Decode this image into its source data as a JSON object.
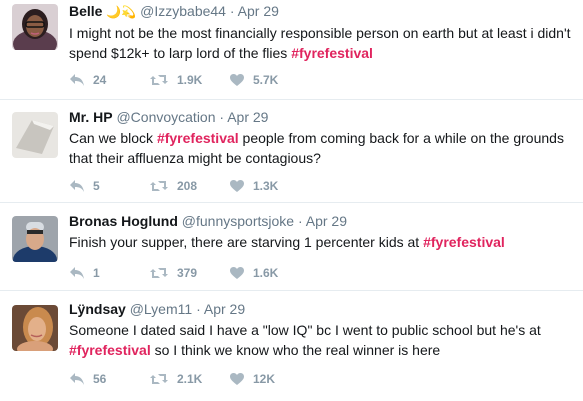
{
  "tweets": [
    {
      "name": "Belle",
      "name_emoji": "🌙💫",
      "handle": "@Izzybabe44",
      "dot": "·",
      "time": "Apr 29",
      "text_before": "I might not be the most financially responsible person on earth but at least i didn't spend $12k+ to larp lord of the flies ",
      "hashtag": "#fyrefestival",
      "text_after": "",
      "replies": "24",
      "retweets": "1.9K",
      "likes": "5.7K"
    },
    {
      "name": "Mr. HP",
      "handle": "@Convoycation",
      "dot": "·",
      "time": "Apr 29",
      "text_before": "Can we block ",
      "hashtag": "#fyrefestival",
      "text_after": " people from coming back for a while on the grounds that their affluenza might be contagious?",
      "replies": "5",
      "retweets": "208",
      "likes": "1.3K"
    },
    {
      "name": "Bronas Hoglund",
      "handle": "@funnysportsjoke",
      "dot": "·",
      "time": "Apr 29",
      "text_before": "Finish your supper, there are starving 1 percenter kids at ",
      "hashtag": "#fyrefestival",
      "text_after": "",
      "replies": "1",
      "retweets": "379",
      "likes": "1.6K"
    },
    {
      "name": "Lÿndsay",
      "handle": "@Lyem11",
      "dot": "·",
      "time": "Apr 29",
      "text_before": "Someone I dated said I have a \"low IQ\" bc I went to public school but he's at ",
      "hashtag": "#fyrefestival",
      "text_after": " so I think we know who the real winner is here",
      "replies": "56",
      "retweets": "2.1K",
      "likes": "12K"
    }
  ],
  "colors": {
    "hashtag": "#e0245e",
    "action_gray": "#8899a6",
    "meta_gray": "#657786",
    "divider": "#e6ecf0"
  },
  "icons": [
    "reply-icon",
    "retweet-icon",
    "like-icon"
  ]
}
